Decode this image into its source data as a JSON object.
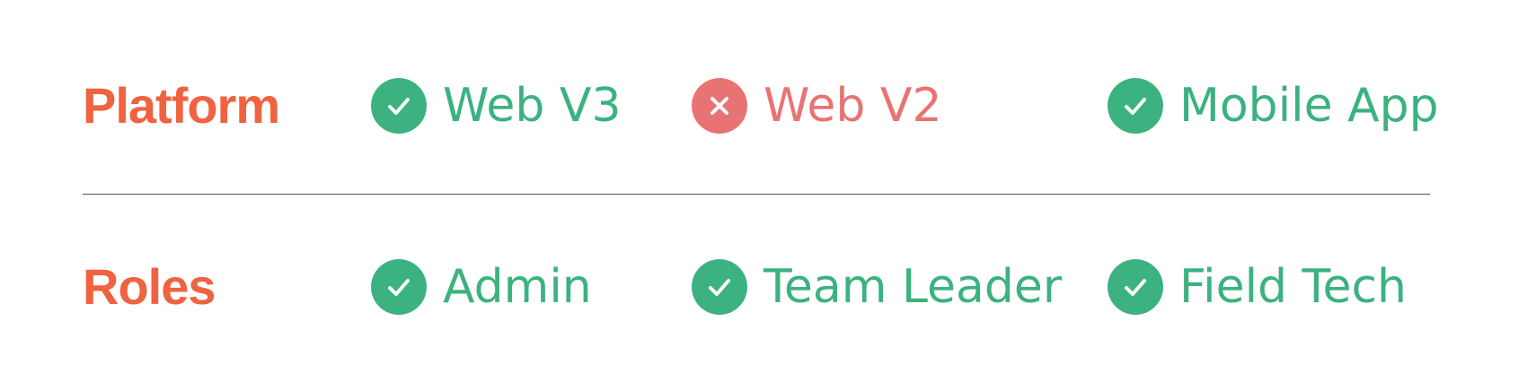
{
  "colors": {
    "label": "#ef6340",
    "ok": "#3bb27f",
    "error": "#e97373",
    "divider": "#555555"
  },
  "platform": {
    "label": "Platform",
    "items": [
      {
        "text": "Web V3",
        "status": "check-icon"
      },
      {
        "text": "Web V2",
        "status": "x-icon"
      },
      {
        "text": "Mobile App",
        "status": "check-icon"
      }
    ]
  },
  "roles": {
    "label": "Roles",
    "items": [
      {
        "text": "Admin",
        "status": "check-icon"
      },
      {
        "text": "Team Leader",
        "status": "check-icon"
      },
      {
        "text": "Field Tech",
        "status": "check-icon"
      }
    ]
  }
}
